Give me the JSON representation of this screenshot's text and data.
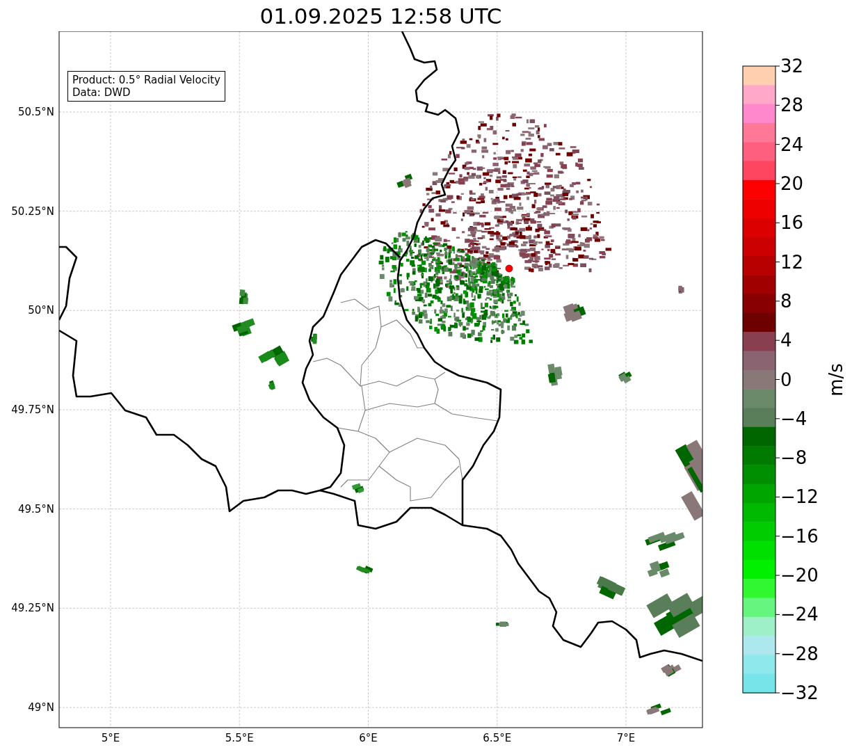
{
  "title": "01.09.2025 12:58 UTC",
  "info_box": {
    "lines": [
      "Product: 0.5° Radial Velocity",
      "Data: DWD"
    ]
  },
  "map": {
    "yticks": [
      "50.5°N",
      "50.25°N",
      "50°N",
      "49.75°N",
      "49.5°N",
      "49.25°N",
      "49°N"
    ],
    "xticks": [
      "5°E",
      "5.5°E",
      "6°E",
      "6.5°E",
      "7°E"
    ]
  },
  "colorbar": {
    "label": "m/s",
    "ticks": [
      "32",
      "28",
      "24",
      "20",
      "16",
      "12",
      "8",
      "4",
      "0",
      "−4",
      "−8",
      "−12",
      "−16",
      "−20",
      "−24",
      "−28",
      "−32"
    ],
    "segments": [
      {
        "color": "#ffcfb0"
      },
      {
        "color": "#ffa8c8"
      },
      {
        "color": "#ff88cc"
      },
      {
        "color": "#ff7898"
      },
      {
        "color": "#ff5f7e"
      },
      {
        "color": "#ff4660"
      },
      {
        "color": "#ff0000"
      },
      {
        "color": "#ee0000"
      },
      {
        "color": "#dd0000"
      },
      {
        "color": "#cc0000"
      },
      {
        "color": "#b80000"
      },
      {
        "color": "#a00000"
      },
      {
        "color": "#880000"
      },
      {
        "color": "#6e0000"
      },
      {
        "color": "#884050"
      },
      {
        "color": "#8a6470"
      },
      {
        "color": "#8a7878"
      },
      {
        "color": "#6a8a6a"
      },
      {
        "color": "#5a7e5a"
      },
      {
        "color": "#006600"
      },
      {
        "color": "#007b00"
      },
      {
        "color": "#008f00"
      },
      {
        "color": "#00a500"
      },
      {
        "color": "#00b900"
      },
      {
        "color": "#00cd00"
      },
      {
        "color": "#00e000"
      },
      {
        "color": "#00f000"
      },
      {
        "color": "#30f830"
      },
      {
        "color": "#66f57e"
      },
      {
        "color": "#9ef0c8"
      },
      {
        "color": "#ade8ee"
      },
      {
        "color": "#8ee8ec"
      },
      {
        "color": "#76e4e8"
      }
    ]
  }
}
